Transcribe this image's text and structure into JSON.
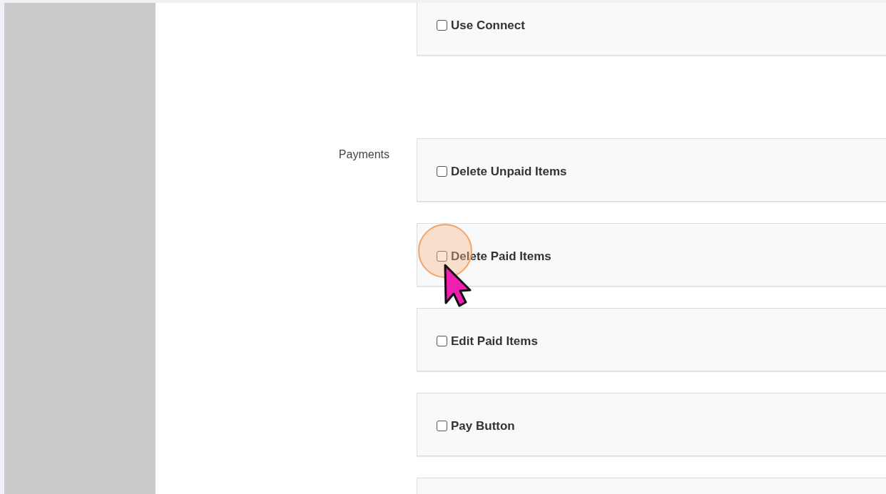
{
  "top_options": [
    {
      "kind": "checkbox",
      "label": "Use Connect",
      "checked": false
    }
  ],
  "sections": [
    {
      "label": "Payments",
      "options": [
        {
          "kind": "checkbox",
          "label": "Delete Unpaid Items",
          "checked": false
        },
        {
          "kind": "checkbox",
          "label": "Delete Paid Items",
          "checked": false
        },
        {
          "kind": "checkbox",
          "label": "Edit Paid Items",
          "checked": false
        },
        {
          "kind": "checkbox",
          "label": "Pay Button",
          "checked": false
        },
        {
          "kind": "blank"
        }
      ]
    }
  ]
}
